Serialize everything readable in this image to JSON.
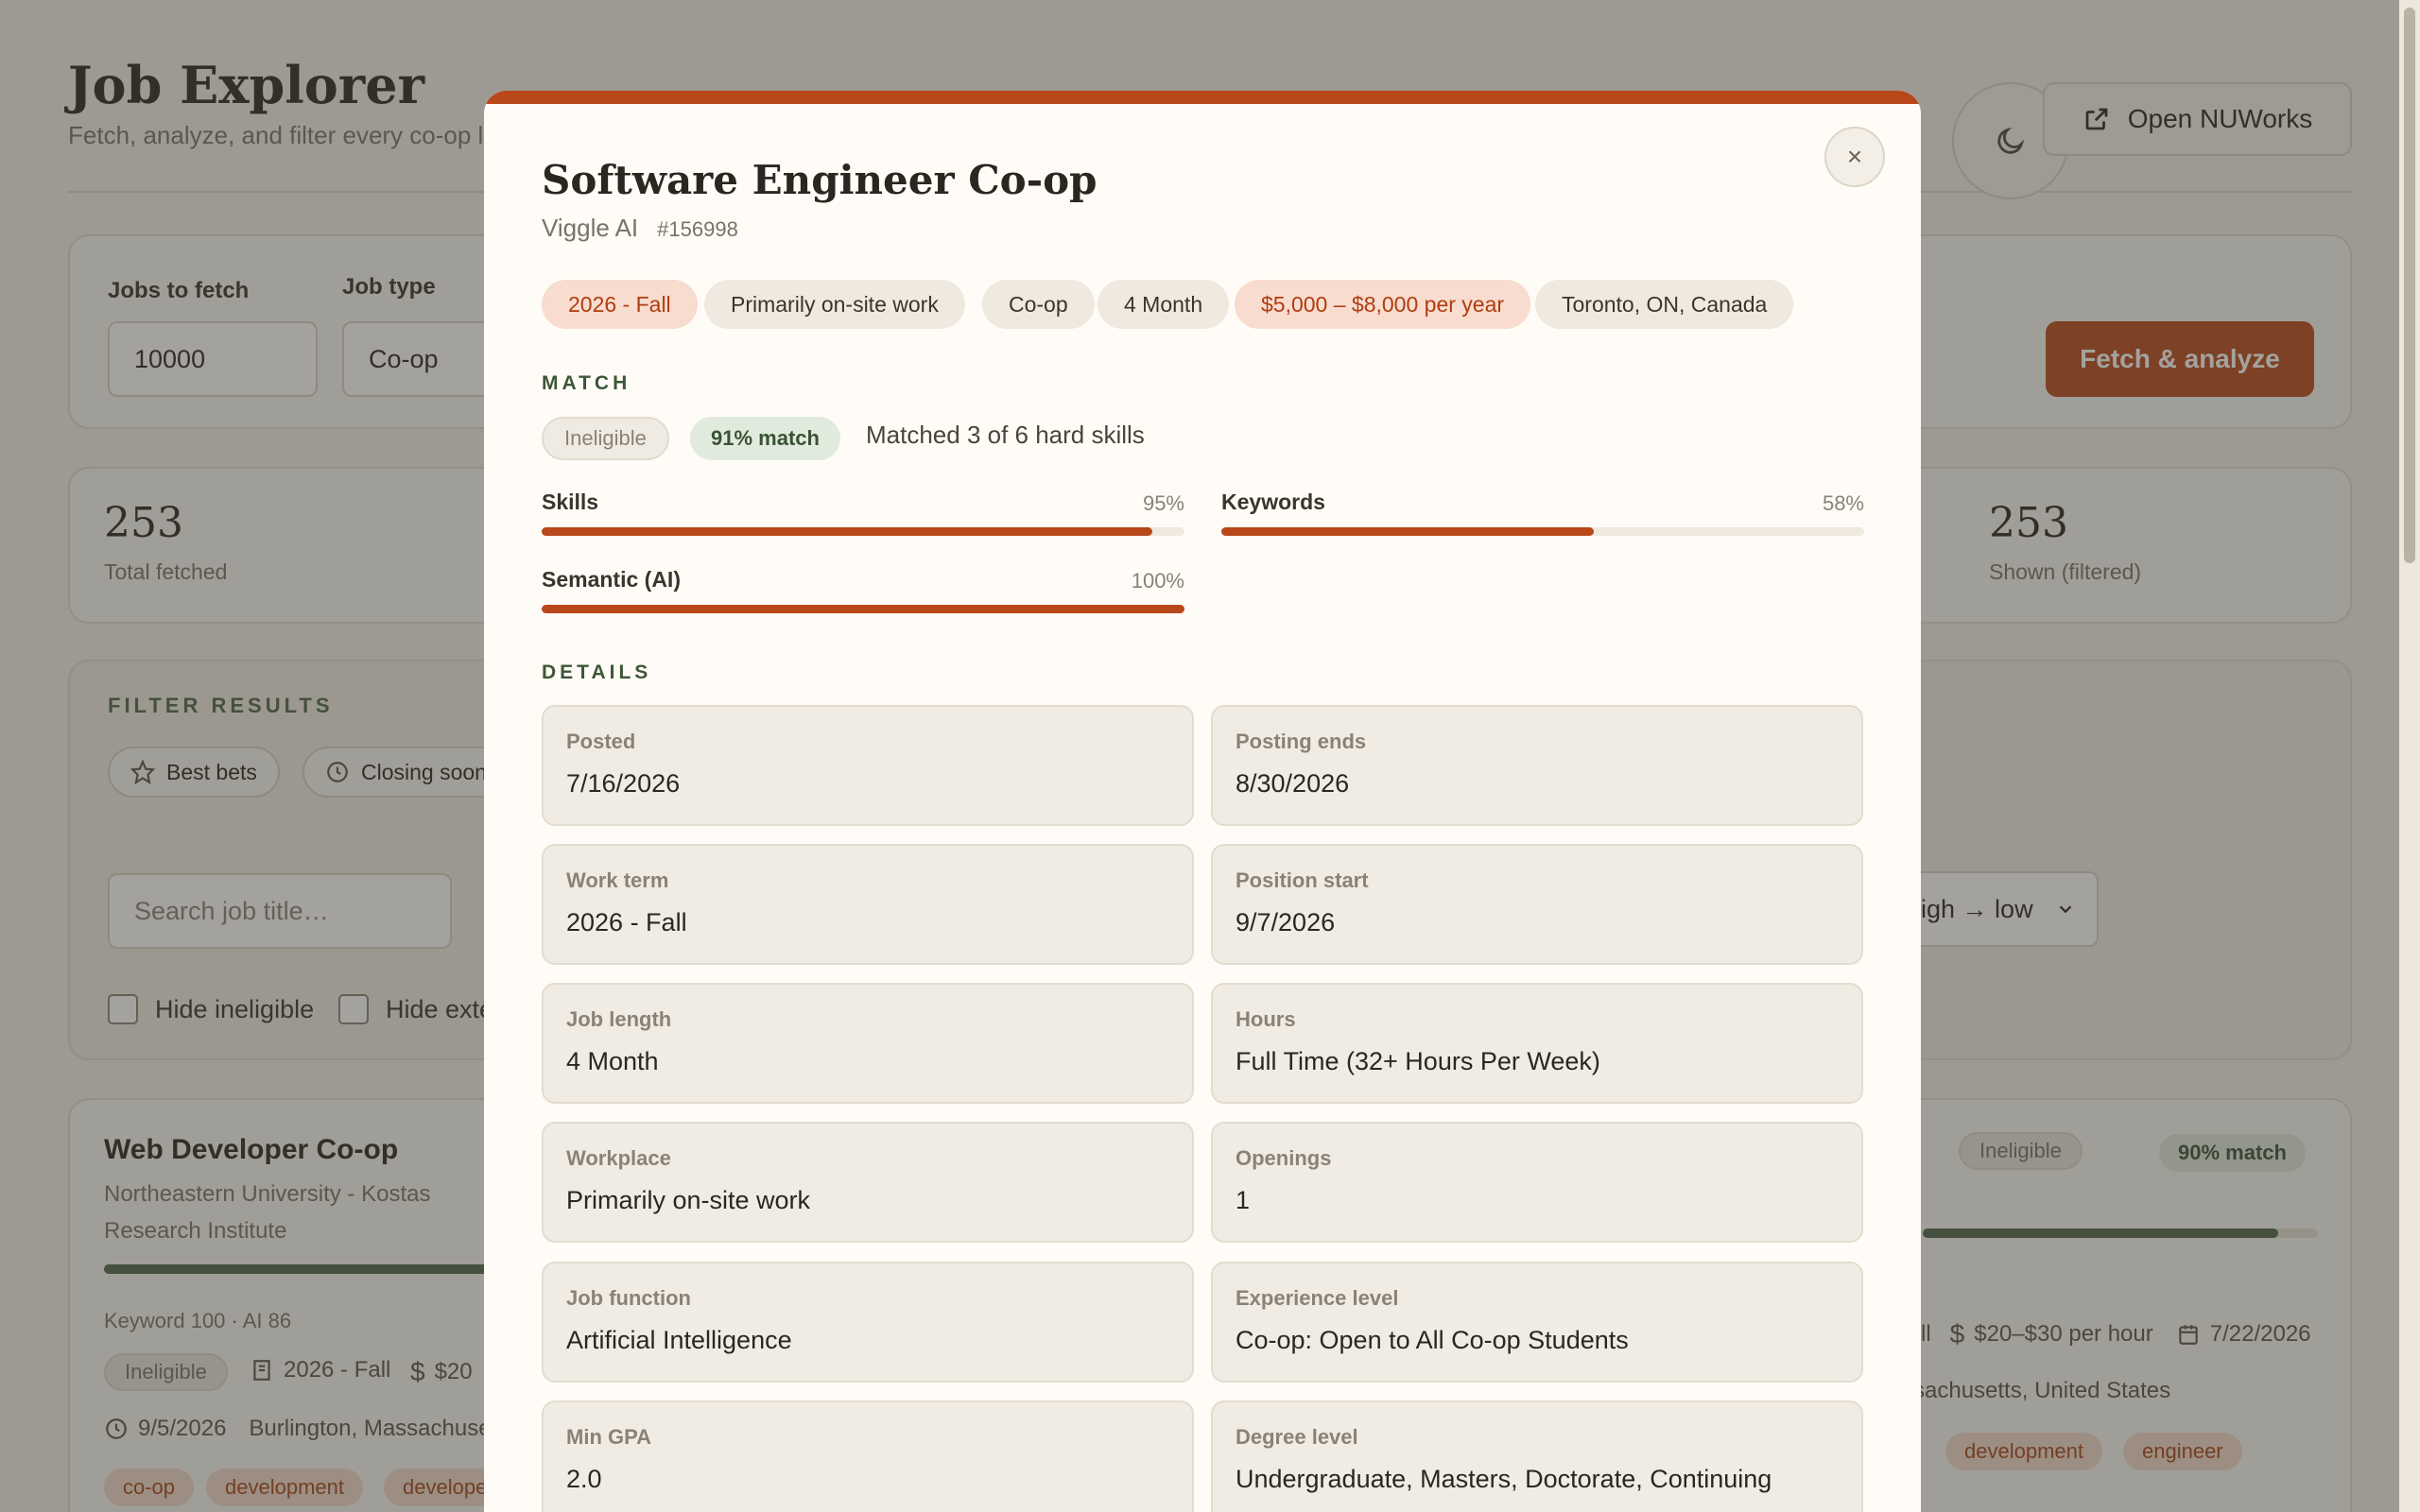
{
  "header": {
    "title": "Job Explorer",
    "subtitle": "Fetch, analyze, and filter every co-op l",
    "nuworks_label": "Open NUWorks"
  },
  "fetch": {
    "jobs_label": "Jobs to fetch",
    "jobs_value": "10000",
    "type_label": "Job type",
    "type_value": "Co-op",
    "button_label": "Fetch & analyze"
  },
  "stats": {
    "total_value": "253",
    "total_label": "Total fetched",
    "shown_value": "253",
    "shown_label": "Shown (filtered)"
  },
  "filters": {
    "heading": "FILTER RESULTS",
    "best_bets": "Best bets",
    "closing_soon": "Closing soon",
    "search_placeholder": "Search job title…",
    "sort_value": ": high → low",
    "hide_ineligible": "Hide ineligible",
    "hide_external": "Hide exte"
  },
  "card_left": {
    "title": "Web Developer Co-op",
    "company": "Northeastern University - Kostas Research Institute",
    "scores": "Keyword 100 · AI 86",
    "eligibility": "Ineligible",
    "term": "2026 - Fall",
    "pay": "$20",
    "deadline": "9/5/2026",
    "location": "Burlington, Massachuset",
    "keywords": [
      "co-op",
      "development",
      "develope"
    ]
  },
  "card_right": {
    "eligibility": "Ineligible",
    "match": "90% match",
    "match_fraction": 0.9,
    "term_tail": "ll",
    "pay": "$20–$30 per hour",
    "deadline": "7/22/2026",
    "location": "sachusetts, United States",
    "keywords": [
      "development",
      "engineer"
    ]
  },
  "modal": {
    "title": "Software Engineer Co-op",
    "company": "Viggle AI",
    "job_id": "#156998",
    "close_label": "×",
    "pills": [
      {
        "label": "2026 - Fall",
        "accent": true
      },
      {
        "label": "Primarily on-site work",
        "accent": false
      },
      {
        "label": "Co-op",
        "accent": false
      },
      {
        "label": "4 Month",
        "accent": false
      },
      {
        "label": "$5,000 – $8,000 per year",
        "accent": true
      },
      {
        "label": "Toronto, ON, Canada",
        "accent": false
      }
    ],
    "match_heading": "MATCH",
    "eligibility": "Ineligible",
    "match_badge": "91% match",
    "match_note": "Matched 3 of 6 hard skills",
    "scores": [
      {
        "label": "Skills",
        "pct_text": "95%",
        "value": 95
      },
      {
        "label": "Keywords",
        "pct_text": "58%",
        "value": 58
      },
      {
        "label": "Semantic (AI)",
        "pct_text": "100%",
        "value": 100
      }
    ],
    "details_heading": "DETAILS",
    "details": [
      {
        "label": "Posted",
        "value": "7/16/2026"
      },
      {
        "label": "Posting ends",
        "value": "8/30/2026"
      },
      {
        "label": "Work term",
        "value": "2026 - Fall"
      },
      {
        "label": "Position start",
        "value": "9/7/2026"
      },
      {
        "label": "Job length",
        "value": "4 Month"
      },
      {
        "label": "Hours",
        "value": "Full Time (32+ Hours Per Week)"
      },
      {
        "label": "Workplace",
        "value": "Primarily on-site work"
      },
      {
        "label": "Openings",
        "value": "1"
      },
      {
        "label": "Job function",
        "value": "Artificial Intelligence"
      },
      {
        "label": "Experience level",
        "value": "Co-op: Open to All Co-op Students"
      },
      {
        "label": "Min GPA",
        "value": "2.0"
      },
      {
        "label": "Degree level",
        "value": "Undergraduate, Masters, Doctorate, Continuing"
      }
    ]
  },
  "colors": {
    "accent": "#b8481a",
    "success": "#4e6448",
    "background": "#f4f0e8"
  },
  "icons": [
    "moon-icon",
    "external-link-icon",
    "star-icon",
    "clock-icon",
    "building-icon",
    "dollar-icon",
    "calendar-icon",
    "close-icon",
    "chevron-down-icon"
  ]
}
